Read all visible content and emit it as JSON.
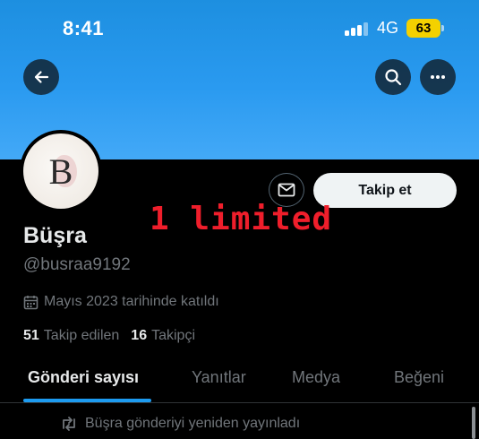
{
  "status_bar": {
    "time": "8:41",
    "network": "4G",
    "battery": "63",
    "battery_color": "#f4d100"
  },
  "header": {
    "back_icon": "arrow-left-icon",
    "search_icon": "search-icon",
    "more_icon": "more-horizontal-icon",
    "banner_color": "#2a9af0"
  },
  "profile": {
    "avatar_letter": "B",
    "display_name": "Büşra",
    "handle": "@busraa9192",
    "joined": "Mayıs 2023 tarihinde katıldı",
    "following_count": "51",
    "following_label": "Takip edilen",
    "followers_count": "16",
    "followers_label": "Takipçi"
  },
  "actions": {
    "message_icon": "envelope-icon",
    "follow_label": "Takip et"
  },
  "overlay": {
    "text": "1 limited",
    "color": "#ef1e2b"
  },
  "tabs": [
    {
      "label": "Gönderi sayısı",
      "active": true
    },
    {
      "label": "Yanıtlar",
      "active": false
    },
    {
      "label": "Medya",
      "active": false
    },
    {
      "label": "Beğeni",
      "active": false
    }
  ],
  "feed": {
    "repost_icon": "repost-icon",
    "repost_text": "Büşra gönderiyi yeniden yayınladı"
  },
  "accent_color": "#1d9bf0"
}
